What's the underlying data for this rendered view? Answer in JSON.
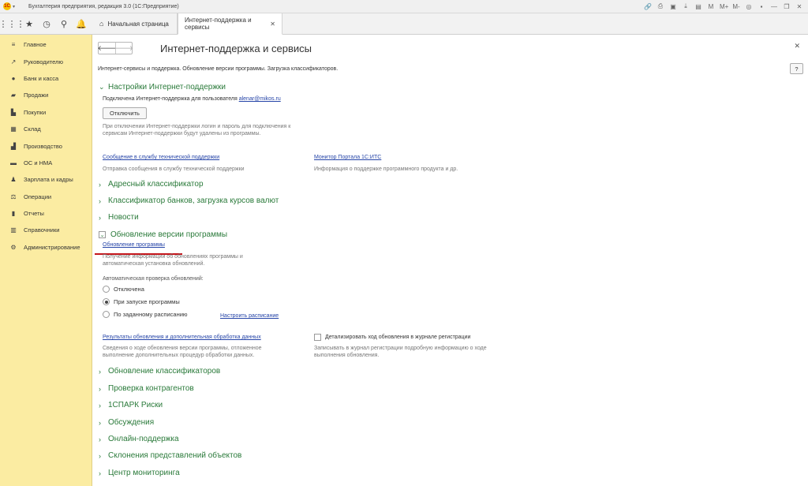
{
  "window": {
    "title": "Бухгалтерия предприятия, редакция 3.0  (1С:Предприятие)",
    "logo": "1С"
  },
  "toptabs": {
    "home_label": "Начальная страница",
    "active_label": "Интернет-поддержка и сервисы"
  },
  "sidebar": {
    "items": [
      {
        "icon": "menu-icon",
        "label": "Главное"
      },
      {
        "icon": "trend-icon",
        "label": "Руководителю"
      },
      {
        "icon": "coin-icon",
        "label": "Банк и касса"
      },
      {
        "icon": "bag-icon",
        "label": "Продажи"
      },
      {
        "icon": "cart-icon",
        "label": "Покупки"
      },
      {
        "icon": "warehouse-icon",
        "label": "Склад"
      },
      {
        "icon": "factory-icon",
        "label": "Производство"
      },
      {
        "icon": "car-icon",
        "label": "ОС и НМА"
      },
      {
        "icon": "people-icon",
        "label": "Зарплата и кадры"
      },
      {
        "icon": "scales-icon",
        "label": "Операции"
      },
      {
        "icon": "chart-icon",
        "label": "Отчеты"
      },
      {
        "icon": "book-icon",
        "label": "Справочники"
      },
      {
        "icon": "gear-icon",
        "label": "Администрирование"
      }
    ]
  },
  "main": {
    "title": "Интернет-поддержка и сервисы",
    "description": "Интернет-сервисы и поддержка. Обновление версии программы. Загрузка классификаторов.",
    "help_label": "?",
    "support": {
      "header": "Настройки Интернет-поддержки",
      "connected_text": "Подключена Интернет-поддержка для пользователя",
      "user_email": "alenar@mikos.ru",
      "disconnect_button": "Отключить",
      "disconnect_note": "При отключении Интернет-поддержки логин и пароль для подключения к сервисам Интернет-поддержки будут удалены из программы.",
      "message_link": "Сообщение в службу технической поддержки",
      "message_desc": "Отправка сообщения в службу технической поддержки",
      "monitor_link": "Монитор Портала 1С:ИТС",
      "monitor_desc": "Информация о поддержке программного продукта и др."
    },
    "collapsed_top": [
      "Адресный классификатор",
      "Классификатор банков, загрузка курсов валют",
      "Новости"
    ],
    "update": {
      "header": "Обновление версии программы",
      "link": "Обновление программы",
      "link_desc": "Получение информации об обновлениях программы и автоматическая установка обновлений.",
      "auto_label": "Автоматическая проверка обновлений:",
      "options": [
        "Отключена",
        "При запуске программы",
        "По заданному расписанию"
      ],
      "selected": "При запуске программы",
      "schedule_link": "Настроить расписание",
      "results_link": "Результаты обновления и дополнительная обработка данных",
      "results_desc": "Сведения о ходе обновления версии программы, отложенное выполнение дополнительных процедур обработки данных.",
      "detail_checkbox": "Детализировать ход обновления в журнале регистрации",
      "detail_desc": "Записывать в журнал регистрации подробную информацию о ходе выполнения обновления."
    },
    "collapsed_bottom": [
      "Обновление классификаторов",
      "Проверка контрагентов",
      "1СПАРК Риски",
      "Обсуждения",
      "Онлайн-поддержка",
      "Склонения представлений объектов",
      "Центр мониторинга"
    ]
  },
  "colors": {
    "sidebar_bg": "#fbeca2",
    "section_green": "#2a7a3a",
    "link_blue": "#2645a8",
    "highlight_red": "#c4161c"
  }
}
